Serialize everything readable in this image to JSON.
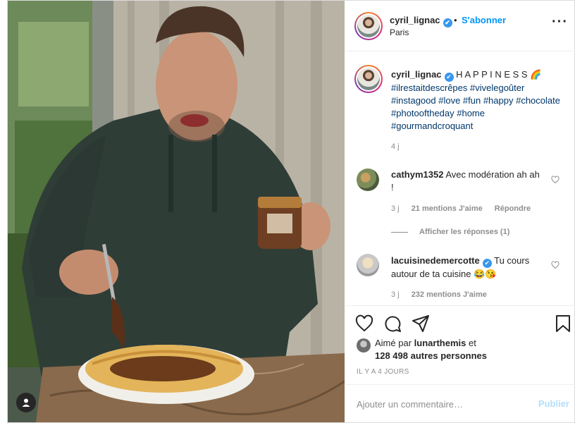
{
  "post": {
    "username": "cyril_lignac",
    "verified_glyph": "✔",
    "separator": "•",
    "follow_label": "S'abonner",
    "location": "Paris",
    "more_icon": "more-horizontal-icon",
    "caption_title": "H A P P I N E S S 🌈",
    "caption_hashtags": "#ilrestaitdescrêpes #vivelegoûter #instagood #love #fun #happy #chocolate #photooftheday #home #gourmandcroquant",
    "caption_time": "4 j"
  },
  "comments": [
    {
      "username": "cathym1352",
      "text": "Avec modération ah ah !",
      "time": "3 j",
      "likes": "21 mentions J'aime",
      "reply_label": "Répondre",
      "show_replies": "Afficher les réponses (1)"
    },
    {
      "username": "lacuisinedemercotte",
      "text": "Tu cours autour de ta cuisine 😂😘",
      "time": "3 j",
      "likes": "232 mentions J'aime"
    }
  ],
  "actions": {
    "icons": [
      "heart-icon",
      "comment-icon",
      "share-icon",
      "bookmark-icon"
    ],
    "liked_prefix": "Aimé par",
    "liked_user": "lunarthemis",
    "liked_suffix": "et",
    "liked_others": "128 498 autres personnes",
    "date": "IL Y A 4 JOURS"
  },
  "add_comment": {
    "placeholder": "Ajouter un commentaire…",
    "publish_label": "Publier"
  },
  "colors": {
    "link_blue": "#0095f6",
    "verified_blue": "#3897f0",
    "hashtag_blue": "#00376b",
    "muted": "#8e8e8e",
    "publish_disabled": "#b2dffc"
  }
}
